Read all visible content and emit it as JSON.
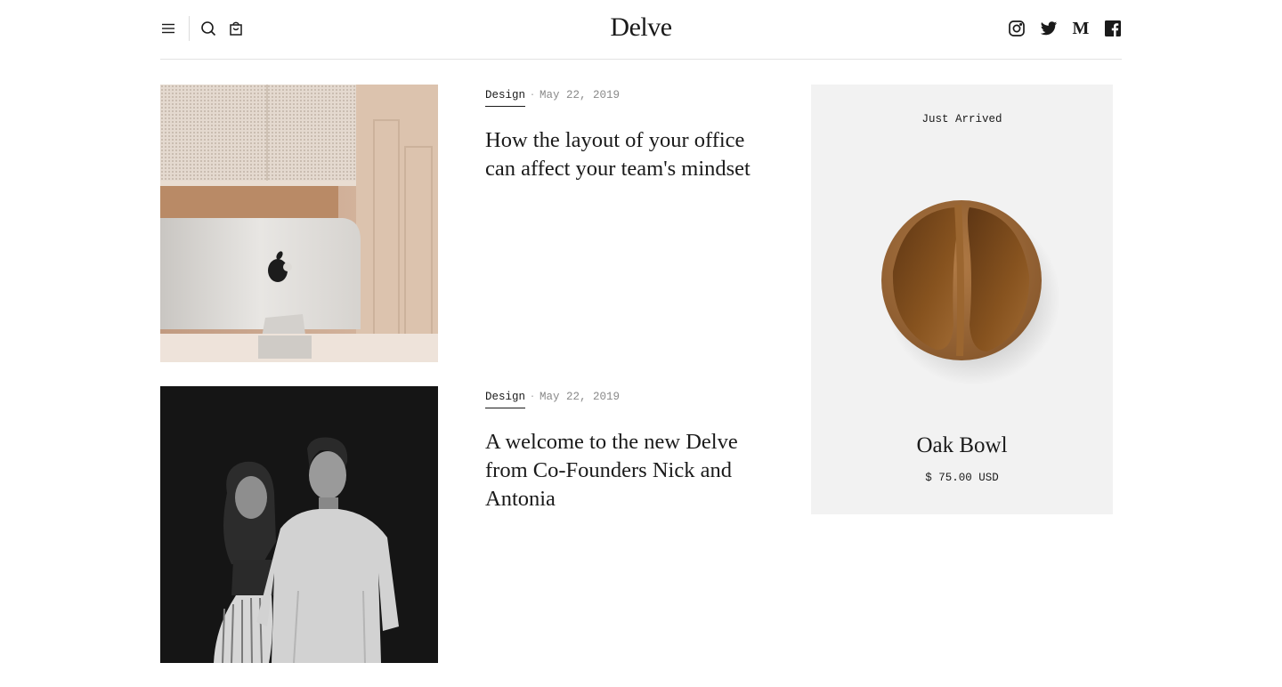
{
  "header": {
    "logo": "Delve",
    "left_icons": [
      "menu-icon",
      "search-icon",
      "cart-icon"
    ],
    "social_icons": [
      "instagram-icon",
      "twitter-icon",
      "medium-icon",
      "facebook-icon"
    ],
    "medium_glyph": "M"
  },
  "posts": [
    {
      "category": "Design",
      "separator": "·",
      "date": "May 22, 2019",
      "title": "How the layout of your office can affect your team's mindset",
      "image": "office-imac-photo"
    },
    {
      "category": "Design",
      "separator": "·",
      "date": "May 22, 2019",
      "title": "A welcome to the new Delve from Co-Founders Nick and Antonia",
      "image": "founders-portrait-photo"
    }
  ],
  "product": {
    "badge": "Just Arrived",
    "name": "Oak Bowl",
    "price": "$ 75.00 USD",
    "image": "oak-bowl-photo"
  },
  "colors": {
    "text": "#1a1a1a",
    "muted": "#8a8a8a",
    "divider": "#e2e2e2",
    "product_bg": "#f2f2f2"
  }
}
